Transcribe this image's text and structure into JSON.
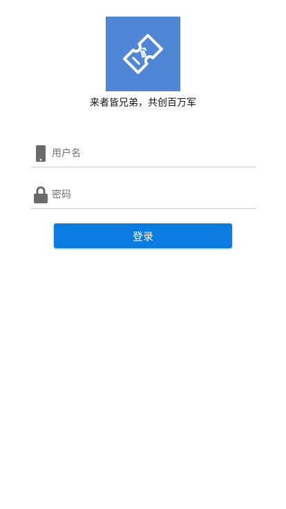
{
  "logo": {
    "icon": "ticket-icon",
    "background": "#4f86d6"
  },
  "slogan": "来者皆兄弟，共创百万军",
  "form": {
    "username": {
      "icon": "phone-icon",
      "placeholder": "用户名",
      "value": ""
    },
    "password": {
      "icon": "lock-icon",
      "placeholder": "密码",
      "value": ""
    },
    "login_label": "登录"
  },
  "colors": {
    "primary": "#0a7be0",
    "divider": "#c6c6c6",
    "icon": "#6b6b6b"
  }
}
